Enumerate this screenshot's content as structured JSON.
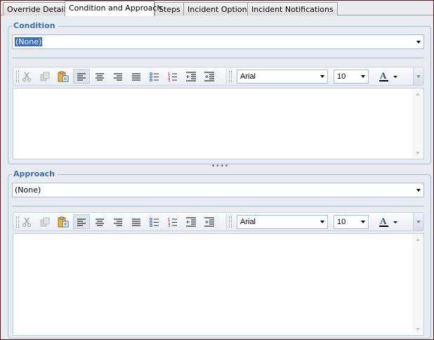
{
  "tabs": [
    {
      "label": "Override Details"
    },
    {
      "label": "Condition and Approach"
    },
    {
      "label": "Steps"
    },
    {
      "label": "Incident Options"
    },
    {
      "label": "Incident Notifications"
    }
  ],
  "active_tab": "Condition and Approach",
  "condition": {
    "title": "Condition",
    "combo_value": "(None)",
    "font": "Arial",
    "size": "10"
  },
  "approach": {
    "title": "Approach",
    "combo_value": "(None)",
    "font": "Arial",
    "size": "10"
  },
  "toolbar_icons": [
    "cut-icon",
    "copy-icon",
    "paste-icon",
    "align-left-icon",
    "align-center-icon",
    "align-right-icon",
    "justify-icon",
    "bullet-list-icon",
    "numbered-list-icon",
    "outdent-icon",
    "indent-icon"
  ],
  "colors": {
    "accent": "#3d6fb4",
    "border": "#9fbbe0",
    "background": "#e8ecf1"
  }
}
